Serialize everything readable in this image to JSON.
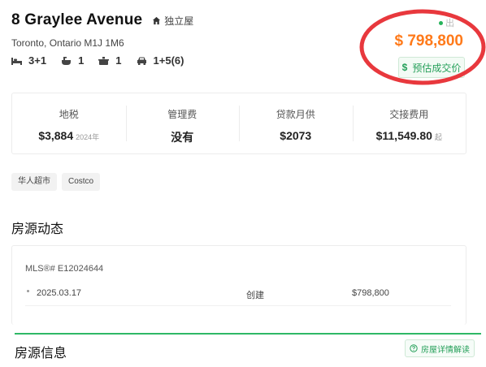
{
  "listing": {
    "title": "8 Graylee Avenue",
    "property_type": "独立屋",
    "address": "Toronto, Ontario M1J 1M6",
    "status": "出",
    "price": "$ 798,800",
    "estimate_label": "预估成交价",
    "estimate_icon": "$",
    "specs": {
      "bedrooms": "3+1",
      "bathrooms": "1",
      "kitchens": "1",
      "parking": "1+5(6)"
    }
  },
  "costs": [
    {
      "label": "地税",
      "value": "$3,884",
      "sub": "2024年"
    },
    {
      "label": "管理费",
      "value": "没有",
      "sub": ""
    },
    {
      "label": "贷款月供",
      "value": "$2073",
      "sub": ""
    },
    {
      "label": "交接费用",
      "value": "$11,549.80",
      "sub": "起"
    }
  ],
  "tags": [
    "华人超市",
    "Costco"
  ],
  "history": {
    "section_title": "房源动态",
    "mls": "MLS®# E12024644",
    "rows": [
      {
        "date": "2025.03.17",
        "event": "创建",
        "price": "$798,800"
      }
    ]
  },
  "info": {
    "section_title": "房源信息",
    "explain_button": "房屋详情解读"
  },
  "colors": {
    "accent_green": "#26a05a",
    "price_orange": "#ff7a1a",
    "annotation_red": "#e8383d"
  },
  "icons": [
    "home-icon",
    "bed-icon",
    "bath-icon",
    "kitchen-icon",
    "car-icon",
    "dollar-icon",
    "question-circle-icon"
  ]
}
